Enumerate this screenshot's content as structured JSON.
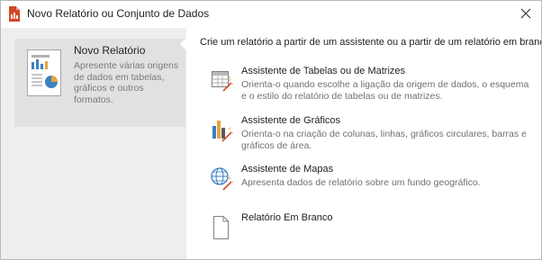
{
  "window": {
    "title": "Novo Relatório ou Conjunto de Dados",
    "app_icon": "report-file-icon",
    "close_icon": "close-icon"
  },
  "sidebar": {
    "new_report": {
      "title": "Novo Relatório",
      "description": "Apresente várias origens de dados em tabelas, gráficos e outros formatos.",
      "icon": "report-thumbnail-icon"
    }
  },
  "main": {
    "intro": "Crie um relatório a partir de um assistente ou a partir de um relatório em branco.",
    "options": [
      {
        "title": "Assistente de Tabelas ou de Matrizes",
        "description": "Orienta-o quando escolhe a ligação da origem de dados, o esquema e o estilo do relatório de tabelas ou de matrizes.",
        "icon": "table-wizard-icon"
      },
      {
        "title": "Assistente de Gráficos",
        "description": "Orienta-o na criação de colunas, linhas, gráficos circulares, barras e gráficos de área.",
        "icon": "chart-wizard-icon"
      },
      {
        "title": "Assistente de Mapas",
        "description": "Apresenta dados de relatório sobre um fundo geográfico.",
        "icon": "map-wizard-icon"
      },
      {
        "title": "Relatório Em Branco",
        "description": "",
        "icon": "blank-page-icon"
      }
    ]
  },
  "colors": {
    "sidebar_bg": "#eeeeee",
    "selected_bg": "#e1e1e1",
    "accent_red": "#d24726",
    "description_gray": "#707070"
  }
}
